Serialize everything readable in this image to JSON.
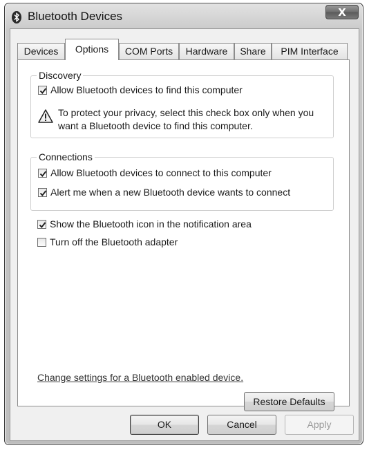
{
  "window": {
    "title": "Bluetooth Devices",
    "close_label": "X"
  },
  "tabs": [
    {
      "label": "Devices",
      "active": false
    },
    {
      "label": "Options",
      "active": true
    },
    {
      "label": "COM Ports",
      "active": false
    },
    {
      "label": "Hardware",
      "active": false
    },
    {
      "label": "Share",
      "active": false
    },
    {
      "label": "PIM Interface",
      "active": false
    }
  ],
  "discovery": {
    "legend": "Discovery",
    "allow_find": {
      "label": "Allow Bluetooth devices to find this computer",
      "checked": true
    },
    "warning": "To protect your privacy, select this check box only when you want a Bluetooth device to find this computer."
  },
  "connections": {
    "legend": "Connections",
    "allow_connect": {
      "label": "Allow Bluetooth devices to connect to this computer",
      "checked": true
    },
    "alert_connect": {
      "label": "Alert me when a new Bluetooth device wants to connect",
      "checked": true
    }
  },
  "options": {
    "show_icon": {
      "label": "Show the Bluetooth icon in the notification area",
      "checked": true
    },
    "turn_off": {
      "label": "Turn off the Bluetooth adapter",
      "checked": false
    }
  },
  "link_text": "Change settings for a Bluetooth enabled device.",
  "buttons": {
    "restore": "Restore Defaults",
    "ok": "OK",
    "cancel": "Cancel",
    "apply": "Apply"
  },
  "colors": {
    "title_bar": "#cfcfcf",
    "close_button": "#6d6d6d",
    "panel_bg": "#ffffff"
  }
}
